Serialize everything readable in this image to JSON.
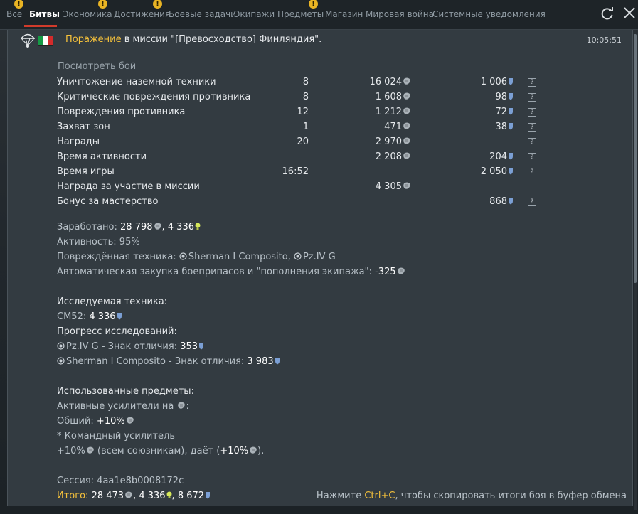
{
  "tabs": [
    {
      "label": "Все",
      "warn": true
    },
    {
      "label": "Битвы",
      "active": true
    },
    {
      "label": "Экономика",
      "warn": true
    },
    {
      "label": "Достижения",
      "warn": true
    },
    {
      "label": "Боевые задачи"
    },
    {
      "label": "Экипажи"
    },
    {
      "label": "Предметы",
      "warn": true
    },
    {
      "label": "Магазин"
    },
    {
      "label": "Мировая война"
    },
    {
      "label": "Системные уведомления"
    }
  ],
  "warning_glyph": "!",
  "icons": {
    "refresh": "refresh-icon",
    "close": "close-icon"
  },
  "message": {
    "result": "Поражение",
    "text": " в миссии \"[Превосходство] Финляндия\".",
    "time": "10:05:51",
    "flag_colors": [
      "#159a45",
      "#ffffff",
      "#d42b2b"
    ]
  },
  "view_battle": "Посмотреть бой",
  "help_glyph": "?",
  "rows": [
    {
      "label": "Уничтожение наземной техники",
      "count": "8",
      "sl": "16 024",
      "rp": "1 006",
      "help": true
    },
    {
      "label": "Критические повреждения противника",
      "count": "8",
      "sl": "1 608",
      "rp": "98",
      "help": true
    },
    {
      "label": "Повреждения противника",
      "count": "12",
      "sl": "1 212",
      "rp": "72",
      "help": true
    },
    {
      "label": "Захват зон",
      "count": "1",
      "sl": "471",
      "rp": "38",
      "help": true
    },
    {
      "label": "Награды",
      "count": "20",
      "sl": "2 970",
      "rp": "",
      "help": true
    },
    {
      "label": "Время активности",
      "count": "",
      "sl": "2 208",
      "rp": "204",
      "help": true
    },
    {
      "label": "Время игры",
      "count": "16:52",
      "sl": "",
      "rp": "2 050",
      "help": true
    },
    {
      "label": "Награда за участие в миссии",
      "count": "",
      "sl": "4 305",
      "rp": "",
      "help": false
    },
    {
      "label": "Бонус за мастерство",
      "count": "",
      "sl": "",
      "rp": "868",
      "help": true
    }
  ],
  "earned": {
    "label": "Заработано:",
    "sl": "28 798",
    "sep": ", ",
    "rp": "4 336"
  },
  "activity": {
    "label": "Активность:",
    "value": "95%"
  },
  "damaged": {
    "label": "Повреждённая техника:",
    "v1": "Sherman I Composito",
    "sep": ", ",
    "v2": "Pz.IV G"
  },
  "autobuy": {
    "label": "Автоматическая закупка боеприпасов и \"пополнения экипажа\":",
    "value": "-325"
  },
  "research": {
    "title": "Исследуемая техника:",
    "vehicle": "CM52:",
    "vehicle_rp": "4 336",
    "progress_title": "Прогресс исследований:",
    "p1_name": "Pz.IV G - Знак отличия:",
    "p1_value": "353",
    "p2_name": "Sherman I Composito - Знак отличия:",
    "p2_value": "3 983"
  },
  "items": {
    "title": "Использованные предметы:",
    "boosters": "Активные усилители на",
    "boosters_suffix": ":",
    "general_label": "Общий:",
    "general_value": "+10%",
    "command": "* Командный усилитель",
    "cmd_value": "+10%",
    "cmd_mid": " (всем союзникам), даёт (",
    "cmd_value2": "+10%",
    "cmd_end": ")."
  },
  "session": {
    "label": "Сессия:",
    "value": "4aa1e8b0008172c"
  },
  "total": {
    "label": "Итого:",
    "sl": "28 473",
    "sep1": ", ",
    "rp": "4 336",
    "sep2": ", ",
    "rp2": "8 672"
  },
  "hint": {
    "pre": "Нажмите ",
    "key": "Ctrl+C",
    "post": ", чтобы скопировать итоги боя в буфер обмена"
  }
}
